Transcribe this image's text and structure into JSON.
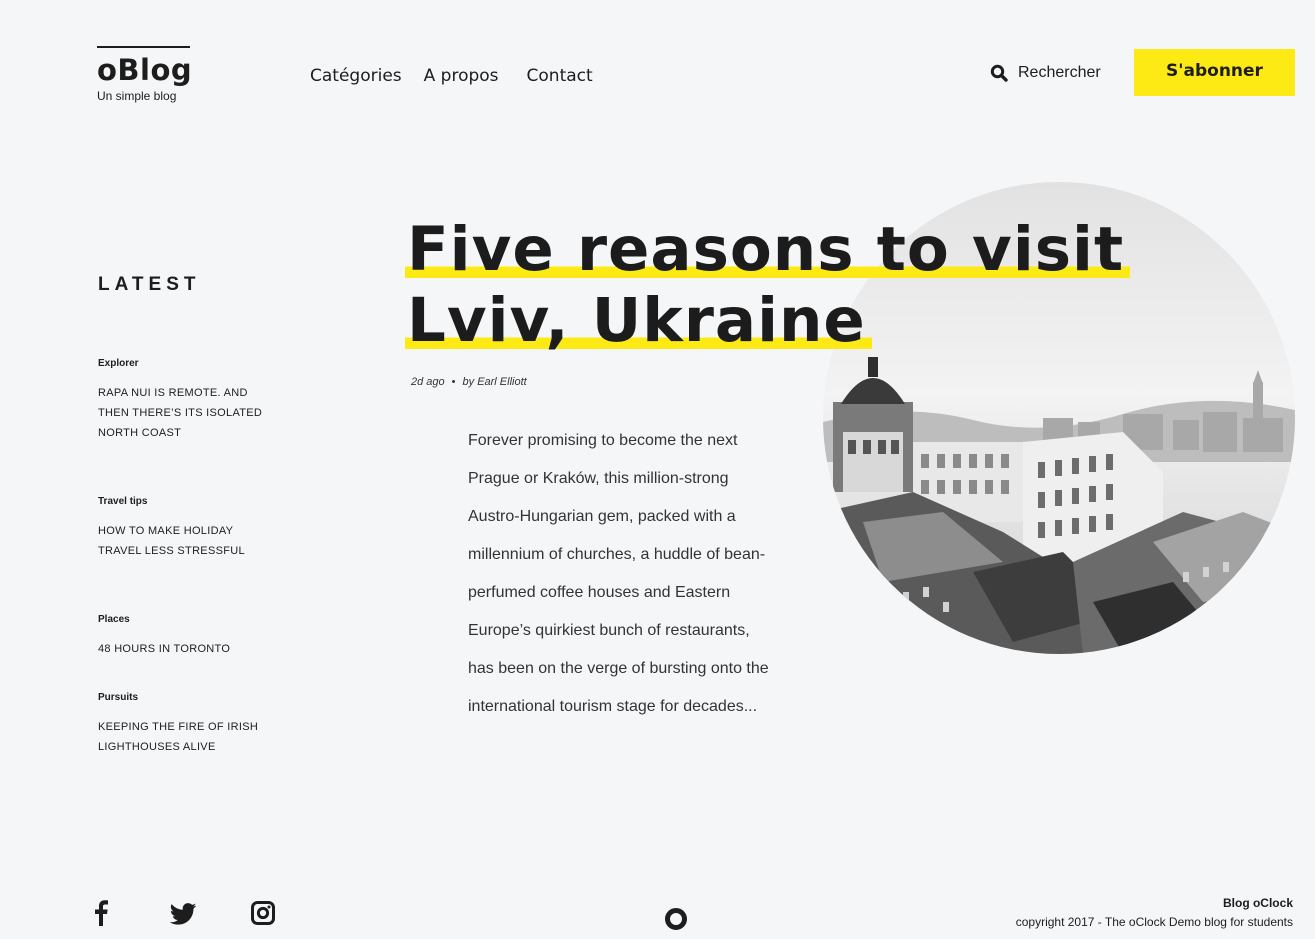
{
  "brand": {
    "name": "oBlog",
    "tagline": "Un simple blog"
  },
  "nav": {
    "items": [
      "Catégories",
      "A propos",
      "Contact"
    ]
  },
  "search": {
    "label": "Rechercher"
  },
  "subscribe": {
    "label": "S'abonner"
  },
  "sidebar": {
    "title": "LATEST",
    "items": [
      {
        "category": "Explorer",
        "title": "RAPA NUI IS REMOTE. AND THEN THERE’S ITS ISOLATED NORTH COAST"
      },
      {
        "category": "Travel tips",
        "title": "HOW TO MAKE HOLIDAY TRAVEL LESS STRESSFUL"
      },
      {
        "category": "Places",
        "title": "48 HOURS IN TORONTO"
      },
      {
        "category": "Pursuits",
        "title": "KEEPING THE FIRE OF IRISH LIGHTHOUSES ALIVE"
      }
    ]
  },
  "post": {
    "title_line1": "Five reasons to visit",
    "title_line2": "Lviv, Ukraine",
    "time": "2d ago",
    "author": "by Earl Elliott",
    "excerpt": "Forever promising to become the next Prague or Kraków, this million-strong Austro-Hungarian gem, packed with a millennium of churches, a huddle of bean-perfumed coffee houses and Eastern Europe’s quirkiest bunch of restaurants, has been on the verge of bursting onto the international tourism stage for decades..."
  },
  "footer": {
    "brand": "Blog oClock",
    "copyright": "copyright 2017 - The oClock Demo blog for students"
  },
  "colors": {
    "accent": "#fdea14",
    "text": "#1d1d1d",
    "background": "#f5f6f8"
  },
  "icons": [
    "search-icon",
    "facebook-icon",
    "twitter-icon",
    "instagram-icon",
    "oclock-logo-icon"
  ]
}
